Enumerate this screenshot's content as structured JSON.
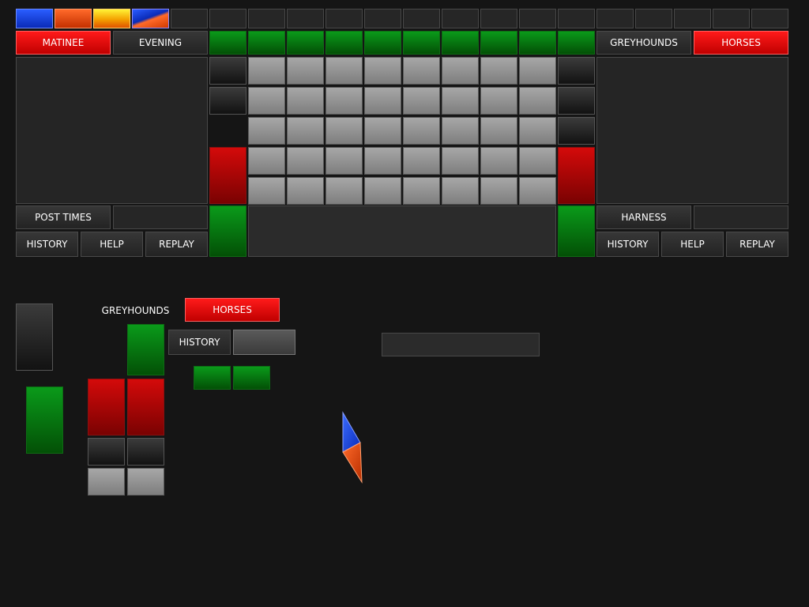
{
  "top_left": {
    "matinee_label": "MATINEE",
    "evening_label": "EVENING",
    "post_times_label": "POST TIMES",
    "history_label": "HISTORY",
    "help_label": "HELP",
    "replay_label": "REPLAY"
  },
  "top_right": {
    "greyhounds_label": "GREYHOUNDS",
    "horses_label": "HORSES",
    "harness_label": "HARNESS",
    "history_label": "HISTORY",
    "help_label": "HELP",
    "replay_label": "REPLAY"
  },
  "lower": {
    "greyhounds_label": "GREYHOUNDS",
    "horses_label": "HORSES",
    "history_label": "HISTORY"
  },
  "colors": {
    "blue": "#2a5dff",
    "orange": "#ff6a2a",
    "yellow": "#ffd800",
    "red_active": "#ff1a1a",
    "green": "#0a9a1a",
    "dark_red": "#b80404"
  },
  "icons": {
    "pointer_shape": "diamond-arrow-icon"
  }
}
